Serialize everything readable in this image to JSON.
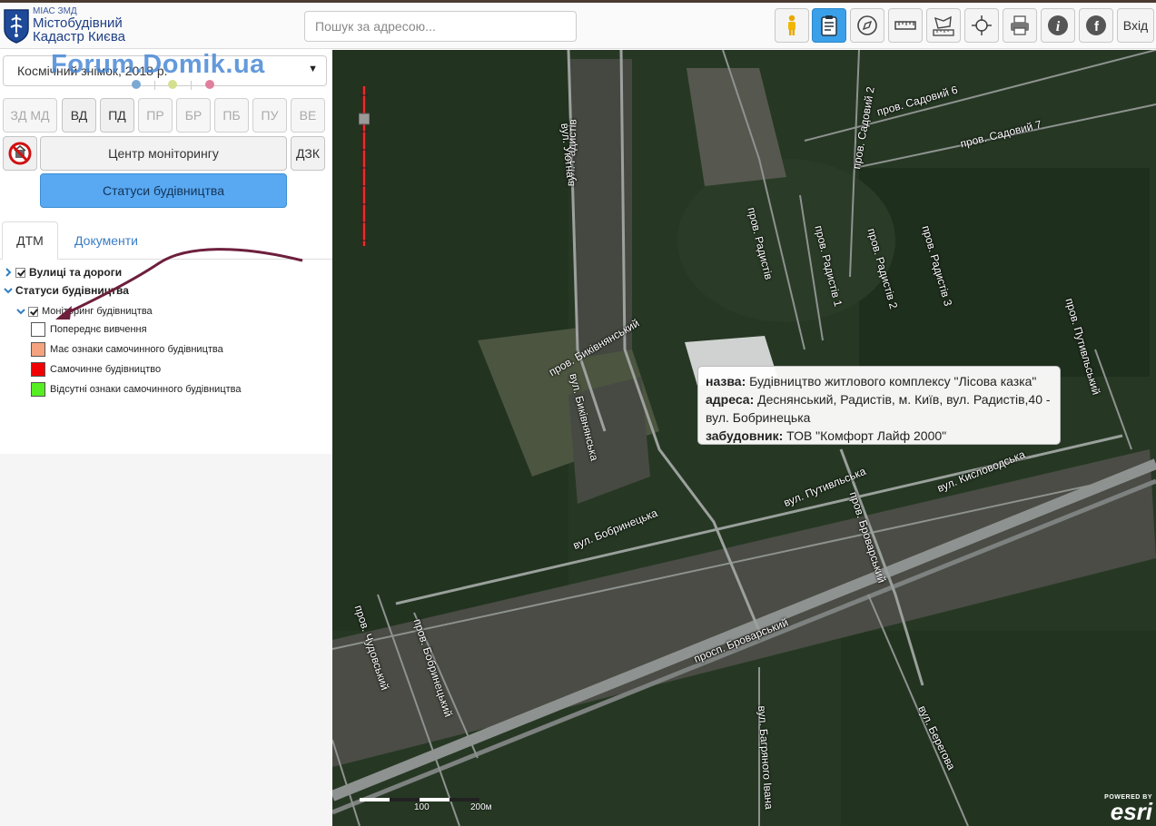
{
  "header": {
    "brand_small": "МІАС ЗМД",
    "brand_line1": "Містобудівний",
    "brand_line2": "Кадастр Києва",
    "search_placeholder": "Пошук за адресою...",
    "login_label": "Вхід",
    "tools": [
      "person-icon",
      "clipboard-icon",
      "compass-icon",
      "ruler-icon",
      "area-measure-icon",
      "crosshair-icon",
      "printer-icon",
      "info-icon",
      "facebook-icon"
    ],
    "active_tool": "clipboard-icon"
  },
  "panel": {
    "layer_select": "Космічний знімок, 2018 р.",
    "watermark": "Forum.Domik.ua",
    "dots": [
      "#7aa9d4",
      "#d6df8f",
      "#e07f9c"
    ],
    "layer_buttons": [
      {
        "label": "ЗД МД",
        "active": false
      },
      {
        "label": "ВД",
        "active": true
      },
      {
        "label": "ПД",
        "active": true
      },
      {
        "label": "ПР",
        "active": false
      },
      {
        "label": "БР",
        "active": false
      },
      {
        "label": "ПБ",
        "active": false
      },
      {
        "label": "ПУ",
        "active": false
      },
      {
        "label": "ВЕ",
        "active": false
      }
    ],
    "monitoring_center": "Центр моніторингу",
    "dzk": "ДЗК",
    "construction_status": "Статуси будівництва",
    "tabs": {
      "dtm": "ДТМ",
      "documents": "Документи"
    },
    "tree": {
      "streets": "Вулиці та дороги",
      "statuses": "Статуси будівництва",
      "monitoring": "Моніторинг будівництва"
    },
    "legend": [
      {
        "label": "Попереднє вивчення",
        "color": "#ffffff"
      },
      {
        "label": "Має ознаки самочинного будівництва",
        "color": "#f4a37e"
      },
      {
        "label": "Самочинне будівництво",
        "color": "#f00000"
      },
      {
        "label": "Відсутні ознаки самочинного будівництва",
        "color": "#55ee22"
      }
    ]
  },
  "map": {
    "streets": [
      {
        "name": "вул. Радистів"
      },
      {
        "name": "вул. Уютна"
      },
      {
        "name": "пров. Садовий 6"
      },
      {
        "name": "пров. Садовий 7"
      },
      {
        "name": "пров. Садовий 2"
      },
      {
        "name": "пров. Радистів"
      },
      {
        "name": "пров. Радистів 1"
      },
      {
        "name": "пров. Радистів 2"
      },
      {
        "name": "пров. Радистів 3"
      },
      {
        "name": "пров. Путивльський"
      },
      {
        "name": "пров. Биківнянський"
      },
      {
        "name": "вул. Биківнянська"
      },
      {
        "name": "вул. Путивльська"
      },
      {
        "name": "вул. Кисловодська"
      },
      {
        "name": "вул. Бобринецька"
      },
      {
        "name": "пров. Броварський"
      },
      {
        "name": "просп. Броварський"
      },
      {
        "name": "пров. Чудовський"
      },
      {
        "name": "пров. Бобринецький"
      },
      {
        "name": "вул. Багряного Івана"
      },
      {
        "name": "вул. Берегова"
      }
    ],
    "popup": {
      "name_label": "назва:",
      "name_value": "Будівництво житлового комплексу \"Лісова казка\"",
      "address_label": "адреса:",
      "address_value": "Деснянський, Радистів, м. Київ, вул. Радистів,40 - вул. Бобринецька",
      "developer_label": "забудовник:",
      "developer_value": "ТОВ \"Комфорт Лайф 2000\""
    },
    "scale": {
      "label_100": "100",
      "label_200": "200м"
    },
    "attribution": {
      "powered_by": "POWERED BY",
      "esri": "esri"
    }
  }
}
